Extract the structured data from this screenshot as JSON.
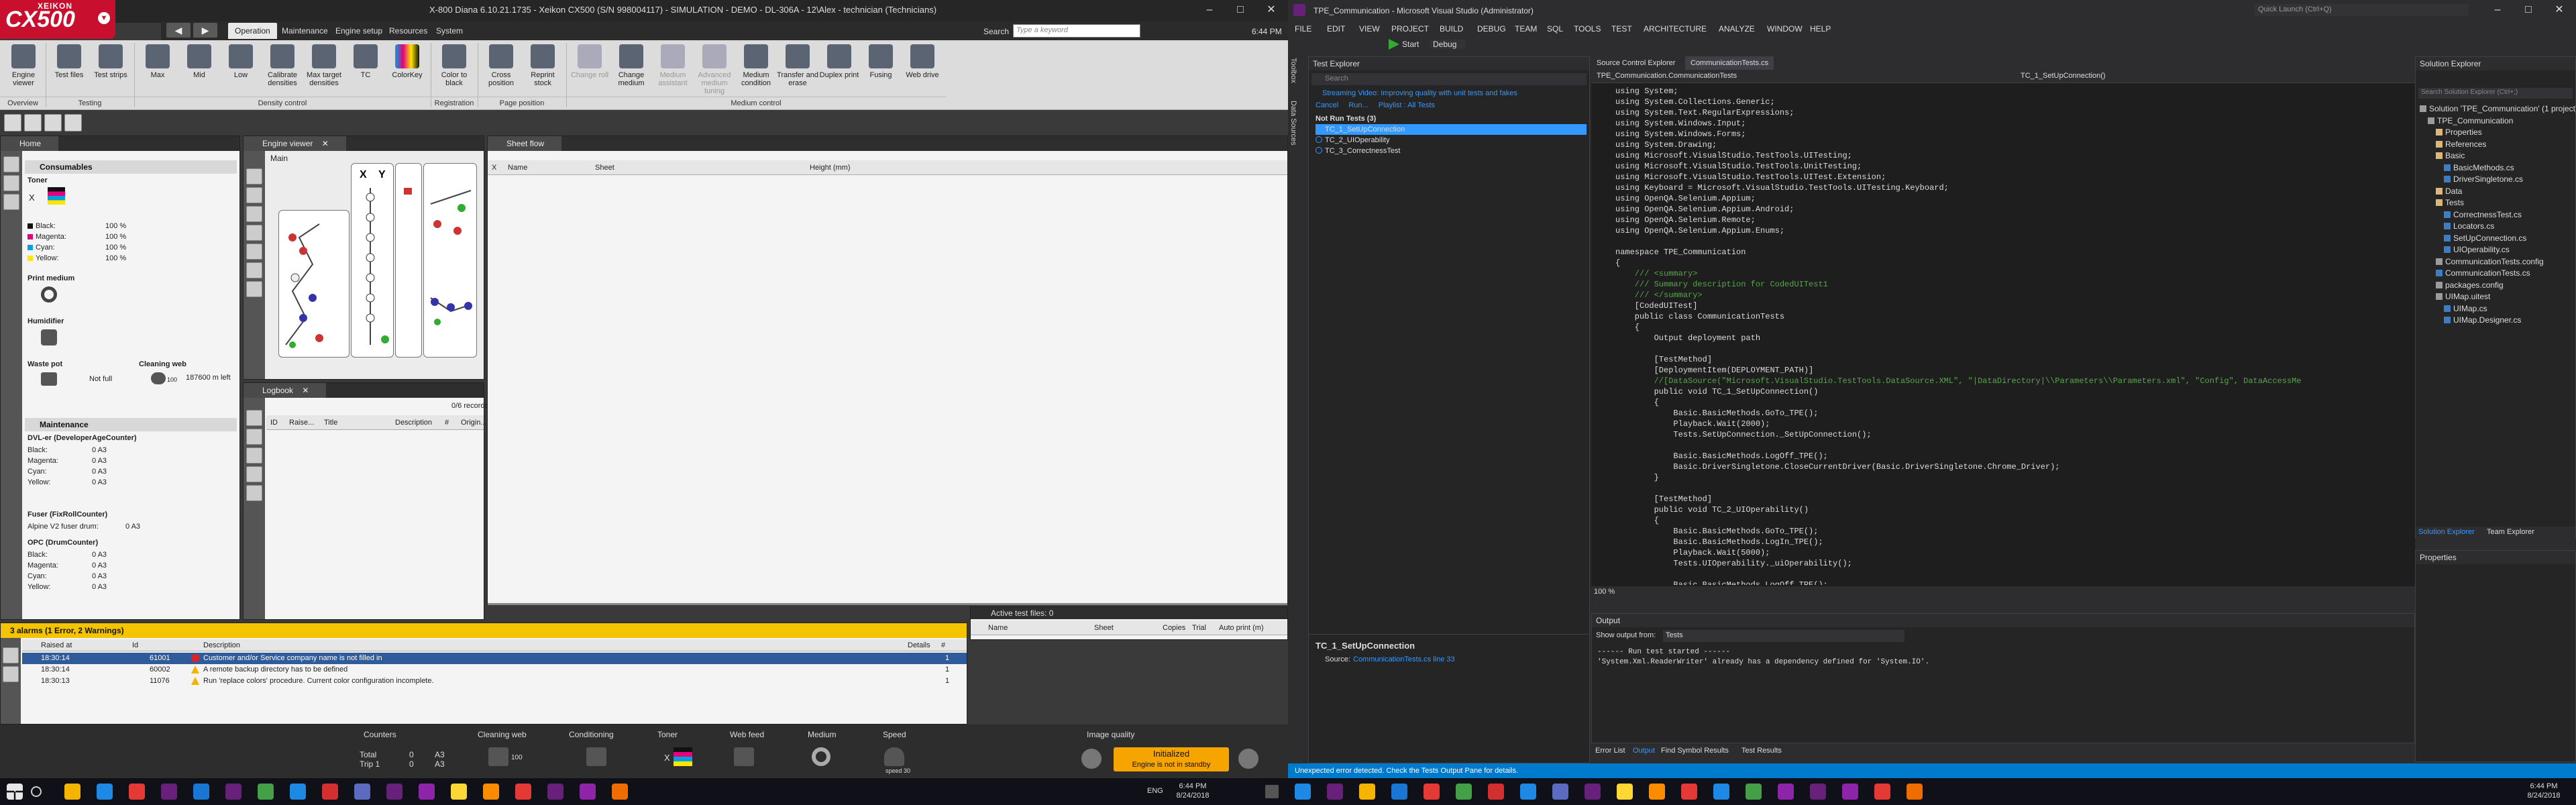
{
  "left_app": {
    "logo": {
      "brand": "XEIKON",
      "model": "CX500"
    },
    "window_title": "X-800 Diana 6.10.21.1735 - Xeikon CX500 (S/N 998004117) - SIMULATION - DEMO - DL-306A - 12\\Alex - technician (Technicians)",
    "menu_tabs": [
      "Operation",
      "Maintenance",
      "Engine setup",
      "Resources",
      "System"
    ],
    "search_label": "Search",
    "search_placeholder": "Type a keyword",
    "time": "6:44 PM",
    "ribbon": {
      "buttons": [
        {
          "label": "Engine viewer",
          "icon": "engine-viewer-icon"
        },
        {
          "label": "Test files",
          "icon": "test-files-icon"
        },
        {
          "label": "Test strips",
          "icon": "test-strips-icon"
        },
        {
          "label": "Max",
          "icon": "max-density-icon"
        },
        {
          "label": "Mid",
          "icon": "mid-density-icon"
        },
        {
          "label": "Low",
          "icon": "low-density-icon"
        },
        {
          "label": "Calibrate densities",
          "icon": "calibrate-icon"
        },
        {
          "label": "Max target densities",
          "icon": "target-icon"
        },
        {
          "label": "TC",
          "icon": "tc-icon"
        },
        {
          "label": "ColorKey",
          "icon": "colorkey-icon"
        },
        {
          "label": "Color to black",
          "icon": "color-to-black-icon"
        },
        {
          "label": "Cross position",
          "icon": "cross-position-icon"
        },
        {
          "label": "Reprint stock",
          "icon": "reprint-icon"
        },
        {
          "label": "Change roll",
          "icon": "change-roll-icon"
        },
        {
          "label": "Change medium",
          "icon": "change-medium-icon"
        },
        {
          "label": "Medium assistant",
          "icon": "medium-assistant-icon"
        },
        {
          "label": "Advanced medium tuning",
          "icon": "advanced-medium-icon"
        },
        {
          "label": "Medium condition",
          "icon": "medium-condition-icon"
        },
        {
          "label": "Transfer and erase",
          "icon": "transfer-erase-icon"
        },
        {
          "label": "Duplex print",
          "icon": "duplex-icon"
        },
        {
          "label": "Fusing",
          "icon": "fusing-icon"
        },
        {
          "label": "Web drive",
          "icon": "web-drive-icon"
        }
      ],
      "groups": [
        "Overview",
        "Testing",
        "Density control",
        "Registration",
        "Page position",
        "Medium control"
      ]
    },
    "home_tab": "Home",
    "consumables": {
      "title": "Consumables",
      "toner": {
        "title": "Toner",
        "x_label": "X",
        "rows": [
          {
            "name": "Black:",
            "value": "100 %",
            "color": "#111111"
          },
          {
            "name": "Magenta:",
            "value": "100 %",
            "color": "#e6007e"
          },
          {
            "name": "Cyan:",
            "value": "100 %",
            "color": "#00a0e3"
          },
          {
            "name": "Yellow:",
            "value": "100 %",
            "color": "#ffe500"
          }
        ]
      },
      "print_medium": "Print medium",
      "humidifier": "Humidifier",
      "waste_pot": {
        "title": "Waste pot",
        "value": "Not full"
      },
      "cleaning_web": {
        "title": "Cleaning web",
        "count": "100",
        "value": "187600 m left"
      }
    },
    "maintenance": {
      "title": "Maintenance",
      "dvl": {
        "title": "DVL-er (DeveloperAgeCounter)",
        "rows": [
          {
            "name": "Black:",
            "value": "0 A3"
          },
          {
            "name": "Magenta:",
            "value": "0 A3"
          },
          {
            "name": "Cyan:",
            "value": "0 A3"
          },
          {
            "name": "Yellow:",
            "value": "0 A3"
          }
        ]
      },
      "fuser": {
        "title": "Fuser (FixRollCounter)",
        "row": {
          "name": "Alpine V2 fuser drum:",
          "value": "0 A3"
        }
      },
      "opc": {
        "title": "OPC (DrumCounter)",
        "rows": [
          {
            "name": "Black:",
            "value": "0 A3"
          },
          {
            "name": "Magenta:",
            "value": "0 A3"
          },
          {
            "name": "Cyan:",
            "value": "0 A3"
          },
          {
            "name": "Yellow:",
            "value": "0 A3"
          }
        ]
      }
    },
    "engine_viewer": {
      "tab": "Engine viewer",
      "main": "Main",
      "x_label": "X",
      "y_label": "Y"
    },
    "logbook": {
      "tab": "Logbook",
      "records": "0/6 records",
      "columns": [
        "ID",
        "Raise...",
        "Title",
        "Description",
        "#",
        "Origin..."
      ]
    },
    "sheet_flow": {
      "tab": "Sheet flow",
      "columns": [
        "X",
        "Name",
        "Sheet",
        "Height (mm)"
      ]
    },
    "active_files": {
      "title": "Active test files: 0",
      "columns": [
        "Name",
        "Sheet",
        "Copies",
        "Trial",
        "Auto print (m)"
      ]
    },
    "alarms": {
      "title": "3 alarms (1 Error, 2 Warnings)",
      "columns": [
        "Raised at",
        "Id",
        "Description",
        "Details",
        "#"
      ],
      "rows": [
        {
          "time": "18:30:14",
          "id": "61001",
          "desc": "Customer and/or Service company name is not filled in",
          "count": "1",
          "severity": "error"
        },
        {
          "time": "18:30:14",
          "id": "60002",
          "desc": "A remote backup directory has to be defined",
          "count": "1",
          "severity": "warning"
        },
        {
          "time": "18:30:13",
          "id": "11076",
          "desc": "Run 'replace colors' procedure. Current color configuration incomplete.",
          "count": "1",
          "severity": "warning"
        }
      ]
    },
    "status_bar": {
      "counters": {
        "label": "Counters",
        "total_label": "Total",
        "total_value": "0",
        "total_unit": "A3",
        "trip_label": "Trip 1",
        "trip_value": "0",
        "trip_unit": "A3"
      },
      "cleaning_web": {
        "label": "Cleaning web",
        "count": "100"
      },
      "conditioning": "Conditioning",
      "toner": {
        "label": "Toner",
        "x": "X"
      },
      "web_feed": "Web feed",
      "medium": "Medium",
      "speed": {
        "label": "Speed",
        "value": "speed 30"
      },
      "image_quality": "Image quality",
      "state": {
        "title": "Initialized",
        "sub": "Engine is not in standby"
      }
    }
  },
  "right_app": {
    "window_title": "TPE_Communication - Microsoft Visual Studio (Administrator)",
    "quick_launch": "Quick Launch (Ctrl+Q)",
    "menu": [
      "FILE",
      "EDIT",
      "VIEW",
      "PROJECT",
      "BUILD",
      "DEBUG",
      "TEAM",
      "SQL",
      "TOOLS",
      "TEST",
      "ARCHITECTURE",
      "ANALYZE",
      "WINDOW",
      "HELP"
    ],
    "toolbar": {
      "start": "Start",
      "config": "Debug"
    },
    "vertical_tabs": [
      "Toolbox",
      "Data Sources"
    ],
    "test_explorer": {
      "title": "Test Explorer",
      "search_placeholder": "Search",
      "banner": "Streaming Video: Improving quality with unit tests and fakes",
      "actions": [
        "Cancel",
        "Run...",
        "Playlist : All Tests"
      ],
      "group": "Not Run Tests (3)",
      "tests": [
        "TC_1_SetUpConnection",
        "TC_2_UIOperability",
        "TC_3_CorrectnessTest"
      ],
      "detail_title": "TC_1_SetUpConnection",
      "detail_source_label": "Source:",
      "detail_source": "CommunicationTests.cs line 33"
    },
    "editor_tabs": [
      "Source Control Explorer",
      "CommunicationTests.cs"
    ],
    "nav_left": "TPE_Communication.CommunicationTests",
    "nav_right": "TC_1_SetUpConnection()",
    "code_lines": [
      "using System;",
      "using System.Collections.Generic;",
      "using System.Text.RegularExpressions;",
      "using System.Windows.Input;",
      "using System.Windows.Forms;",
      "using System.Drawing;",
      "using Microsoft.VisualStudio.TestTools.UITesting;",
      "using Microsoft.VisualStudio.TestTools.UnitTesting;",
      "using Microsoft.VisualStudio.TestTools.UITest.Extension;",
      "using Keyboard = Microsoft.VisualStudio.TestTools.UITesting.Keyboard;",
      "using OpenQA.Selenium.Appium;",
      "using OpenQA.Selenium.Appium.Android;",
      "using OpenQA.Selenium.Remote;",
      "using OpenQA.Selenium.Appium.Enums;",
      "",
      "namespace TPE_Communication",
      "{",
      "    /// <summary>",
      "    /// Summary description for CodedUITest1",
      "    /// </summary>",
      "    [CodedUITest]",
      "    public class CommunicationTests",
      "    {",
      "        Output deployment path",
      "",
      "        [TestMethod]",
      "        [DeploymentItem(DEPLOYMENT_PATH)]",
      "        //[DataSource(\"Microsoft.VisualStudio.TestTools.DataSource.XML\", \"|DataDirectory|\\\\Parameters\\\\Parameters.xml\", \"Config\", DataAccessMe",
      "        public void TC_1_SetUpConnection()",
      "        {",
      "            Basic.BasicMethods.GoTo_TPE();",
      "            Playback.Wait(2000);",
      "            Tests.SetUpConnection._SetUpConnection();",
      "",
      "            Basic.BasicMethods.LogOff_TPE();",
      "            Basic.DriverSingletone.CloseCurrentDriver(Basic.DriverSingletone.Chrome_Driver);",
      "        }",
      "",
      "        [TestMethod]",
      "        public void TC_2_UIOperability()",
      "        {",
      "            Basic.BasicMethods.GoTo_TPE();",
      "            Basic.BasicMethods.LogIn_TPE();",
      "            Playback.Wait(5000);",
      "            Tests.UIOperability._uiOperability();",
      "",
      "            Basic.BasicMethods.LogOff_TPE();"
    ],
    "zoom": "100 %",
    "output": {
      "title": "Output",
      "show_from_label": "Show output from:",
      "show_from_value": "Tests",
      "lines": [
        "------ Run test started ------",
        "'System.Xml.ReaderWriter' already has a dependency defined for 'System.IO'."
      ]
    },
    "bottom_tabs": [
      "Error List",
      "Output",
      "Find Symbol Results",
      "Test Results"
    ],
    "status": "Unexpected error detected. Check the Tests Output Pane for details.",
    "solution_explorer": {
      "title": "Solution Explorer",
      "search_placeholder": "Search Solution Explorer (Ctrl+;)",
      "items": [
        {
          "text": "Solution 'TPE_Communication' (1 project)",
          "indent": 0
        },
        {
          "text": "TPE_Communication",
          "indent": 1
        },
        {
          "text": "Properties",
          "indent": 2
        },
        {
          "text": "References",
          "indent": 2
        },
        {
          "text": "Basic",
          "indent": 2
        },
        {
          "text": "BasicMethods.cs",
          "indent": 3
        },
        {
          "text": "DriverSingletone.cs",
          "indent": 3
        },
        {
          "text": "Data",
          "indent": 2
        },
        {
          "text": "Tests",
          "indent": 2
        },
        {
          "text": "CorrectnessTest.cs",
          "indent": 3
        },
        {
          "text": "Locators.cs",
          "indent": 3
        },
        {
          "text": "SetUpConnection.cs",
          "indent": 3
        },
        {
          "text": "UIOperability.cs",
          "indent": 3
        },
        {
          "text": "CommunicationTests.config",
          "indent": 2
        },
        {
          "text": "CommunicationTests.cs",
          "indent": 2
        },
        {
          "text": "packages.config",
          "indent": 2
        },
        {
          "text": "UIMap.uitest",
          "indent": 2
        },
        {
          "text": "UIMap.cs",
          "indent": 3
        },
        {
          "text": "UIMap.Designer.cs",
          "indent": 3
        }
      ],
      "tabs": [
        "Solution Explorer",
        "Team Explorer"
      ]
    },
    "properties": {
      "title": "Properties"
    }
  },
  "taskbar": {
    "left_time": "6:44 PM",
    "left_date": "8/24/2018",
    "left_lang": "ENG",
    "right_time": "6:44 PM",
    "right_date": "8/24/2018"
  }
}
